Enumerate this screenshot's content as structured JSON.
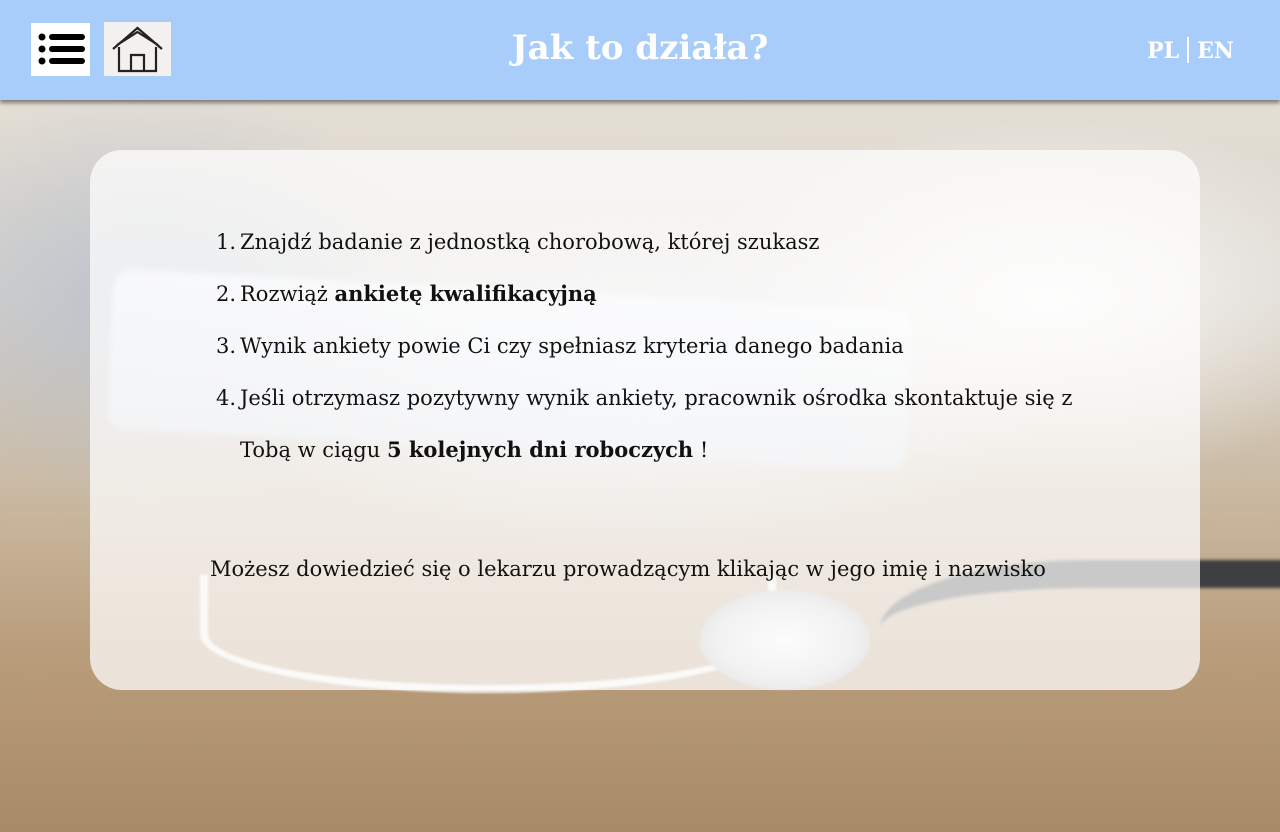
{
  "header": {
    "title": "Jak to działa?",
    "menu_icon": "menu-list-icon",
    "home_icon": "home-icon",
    "background_color": "#a9cdfb",
    "languages": [
      "PL",
      "EN"
    ]
  },
  "content": {
    "steps": [
      {
        "number": "1.",
        "text": "Znajdź badanie z jednostką chorobową, której szukasz"
      },
      {
        "number": "2.",
        "text_before": "Rozwiąż ",
        "bold": "ankietę kwalifikacyjną"
      },
      {
        "number": "3.",
        "text": "Wynik ankiety powie Ci czy spełniasz kryteria danego badania"
      },
      {
        "number": "4.",
        "text_before": "Jeśli otrzymasz pozytywny wynik ankiety, pracownik ośrodka skontaktuje się z Tobą w ciągu ",
        "bold": "5 kolejnych dni roboczych",
        "text_after": " !"
      }
    ],
    "note": "Możesz dowiedzieć się o lekarzu prowadzącym klikając w jego imię i nazwisko"
  }
}
